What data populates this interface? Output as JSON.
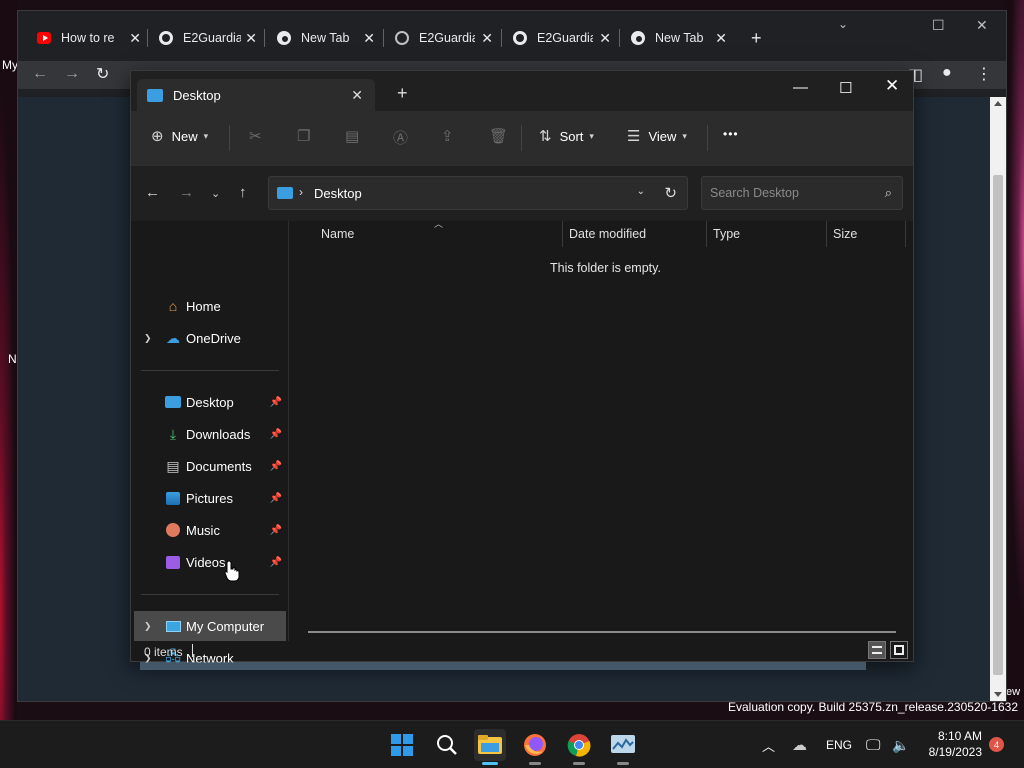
{
  "chrome": {
    "tabs": [
      {
        "label": "How to re",
        "icon": "youtube-icon"
      },
      {
        "label": "E2Guardia",
        "icon": "github-icon"
      },
      {
        "label": "New Tab",
        "icon": "chrome-icon"
      },
      {
        "label": "E2Guardia",
        "icon": "globe-icon"
      },
      {
        "label": "E2Guardia",
        "icon": "github-icon"
      },
      {
        "label": "New Tab",
        "icon": "chrome-icon"
      }
    ],
    "new_tab_symbol": "+"
  },
  "desktop_fragments": {
    "top_left": "My",
    "bottom_left": "N",
    "right_edge": "ew"
  },
  "explorer": {
    "tab_title": "Desktop",
    "commands": {
      "new": "New",
      "sort": "Sort",
      "view": "View",
      "more": "•••"
    },
    "address": {
      "crumb": "Desktop",
      "search_placeholder": "Search Desktop"
    },
    "nav": {
      "top": [
        {
          "label": "Home",
          "icon": "home-icon"
        },
        {
          "label": "OneDrive",
          "icon": "onedrive-icon"
        }
      ],
      "quick": [
        {
          "label": "Desktop",
          "icon": "desktop-icon"
        },
        {
          "label": "Downloads",
          "icon": "downloads-icon"
        },
        {
          "label": "Documents",
          "icon": "documents-icon"
        },
        {
          "label": "Pictures",
          "icon": "pictures-icon"
        },
        {
          "label": "Music",
          "icon": "music-icon"
        },
        {
          "label": "Videos",
          "icon": "videos-icon"
        }
      ],
      "bottom": [
        {
          "label": "My Computer",
          "icon": "computer-icon",
          "selected": true
        },
        {
          "label": "Network",
          "icon": "network-icon"
        }
      ]
    },
    "columns": [
      "Name",
      "Date modified",
      "Type",
      "Size"
    ],
    "empty_message": "This folder is empty.",
    "status": "0 items"
  },
  "watermark": "Evaluation copy. Build 25375.zn_release.230520-1632",
  "taskbar": {
    "apps": [
      "start-icon",
      "search-icon",
      "file-explorer-icon",
      "firefox-icon",
      "chrome-icon",
      "monitor-app-icon"
    ],
    "language": "ENG",
    "time": "8:10 AM",
    "date": "8/19/2023",
    "notifications": "4"
  }
}
